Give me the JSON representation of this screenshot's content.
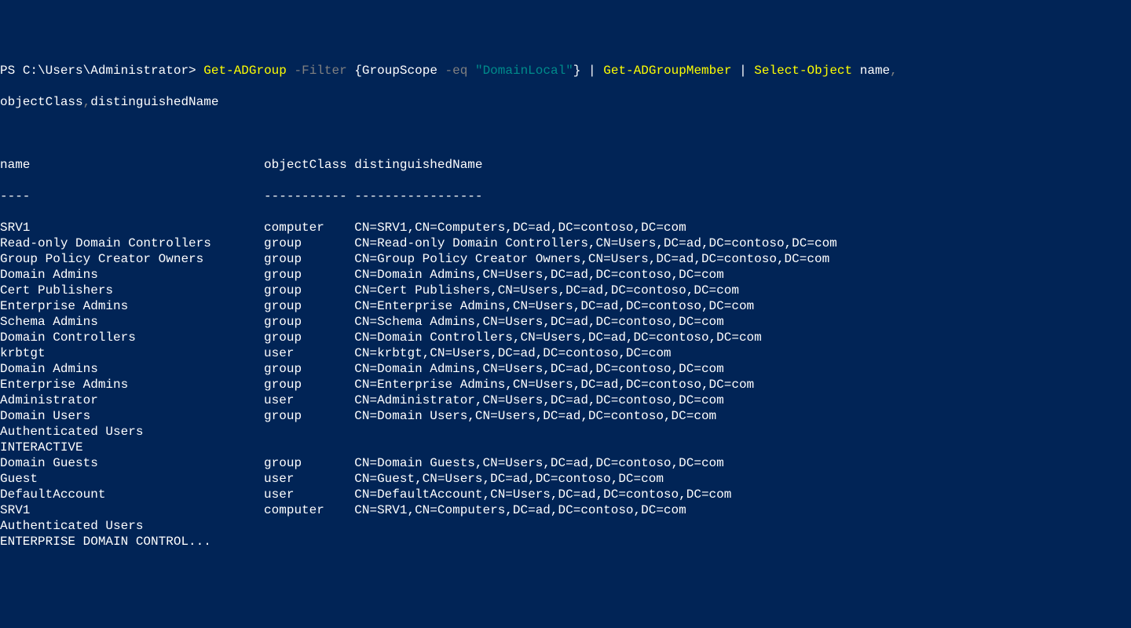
{
  "prompt": {
    "ps": "PS ",
    "path": "C:\\Users\\Administrator> ",
    "cmd1": "Get-ADGroup",
    "space1": " ",
    "flag1": "-Filter",
    "space2": " ",
    "brace_open": "{",
    "filter_prop": "GroupScope ",
    "filter_op": "-eq",
    "space3": " ",
    "filter_val": "\"DomainLocal\"",
    "brace_close": "}",
    "space4": " ",
    "pipe1": "|",
    "space5": " ",
    "cmd2": "Get-ADGroupMember",
    "space6": " ",
    "pipe2": "|",
    "space7": " ",
    "cmd3": "Select-Object",
    "space8": " ",
    "prop1": "name",
    "comma1": ",",
    "line2_prop2": "objectClass",
    "line2_comma2": ",",
    "line2_prop3": "distinguishedName"
  },
  "header": {
    "col1": "name",
    "col2": "objectClass",
    "col3": "distinguishedName",
    "sep1": "----",
    "sep2": "-----------",
    "sep3": "-----------------"
  },
  "rows": [
    {
      "name": "SRV1",
      "objectClass": "computer",
      "dn": "CN=SRV1,CN=Computers,DC=ad,DC=contoso,DC=com"
    },
    {
      "name": "Read-only Domain Controllers",
      "objectClass": "group",
      "dn": "CN=Read-only Domain Controllers,CN=Users,DC=ad,DC=contoso,DC=com"
    },
    {
      "name": "Group Policy Creator Owners",
      "objectClass": "group",
      "dn": "CN=Group Policy Creator Owners,CN=Users,DC=ad,DC=contoso,DC=com"
    },
    {
      "name": "Domain Admins",
      "objectClass": "group",
      "dn": "CN=Domain Admins,CN=Users,DC=ad,DC=contoso,DC=com"
    },
    {
      "name": "Cert Publishers",
      "objectClass": "group",
      "dn": "CN=Cert Publishers,CN=Users,DC=ad,DC=contoso,DC=com"
    },
    {
      "name": "Enterprise Admins",
      "objectClass": "group",
      "dn": "CN=Enterprise Admins,CN=Users,DC=ad,DC=contoso,DC=com"
    },
    {
      "name": "Schema Admins",
      "objectClass": "group",
      "dn": "CN=Schema Admins,CN=Users,DC=ad,DC=contoso,DC=com"
    },
    {
      "name": "Domain Controllers",
      "objectClass": "group",
      "dn": "CN=Domain Controllers,CN=Users,DC=ad,DC=contoso,DC=com"
    },
    {
      "name": "krbtgt",
      "objectClass": "user",
      "dn": "CN=krbtgt,CN=Users,DC=ad,DC=contoso,DC=com"
    },
    {
      "name": "Domain Admins",
      "objectClass": "group",
      "dn": "CN=Domain Admins,CN=Users,DC=ad,DC=contoso,DC=com"
    },
    {
      "name": "Enterprise Admins",
      "objectClass": "group",
      "dn": "CN=Enterprise Admins,CN=Users,DC=ad,DC=contoso,DC=com"
    },
    {
      "name": "Administrator",
      "objectClass": "user",
      "dn": "CN=Administrator,CN=Users,DC=ad,DC=contoso,DC=com"
    },
    {
      "name": "Domain Users",
      "objectClass": "group",
      "dn": "CN=Domain Users,CN=Users,DC=ad,DC=contoso,DC=com"
    },
    {
      "name": "Authenticated Users",
      "objectClass": "",
      "dn": ""
    },
    {
      "name": "INTERACTIVE",
      "objectClass": "",
      "dn": ""
    },
    {
      "name": "Domain Guests",
      "objectClass": "group",
      "dn": "CN=Domain Guests,CN=Users,DC=ad,DC=contoso,DC=com"
    },
    {
      "name": "Guest",
      "objectClass": "user",
      "dn": "CN=Guest,CN=Users,DC=ad,DC=contoso,DC=com"
    },
    {
      "name": "DefaultAccount",
      "objectClass": "user",
      "dn": "CN=DefaultAccount,CN=Users,DC=ad,DC=contoso,DC=com"
    },
    {
      "name": "SRV1",
      "objectClass": "computer",
      "dn": "CN=SRV1,CN=Computers,DC=ad,DC=contoso,DC=com"
    },
    {
      "name": "Authenticated Users",
      "objectClass": "",
      "dn": ""
    },
    {
      "name": "ENTERPRISE DOMAIN CONTROL...",
      "objectClass": "",
      "dn": ""
    }
  ]
}
